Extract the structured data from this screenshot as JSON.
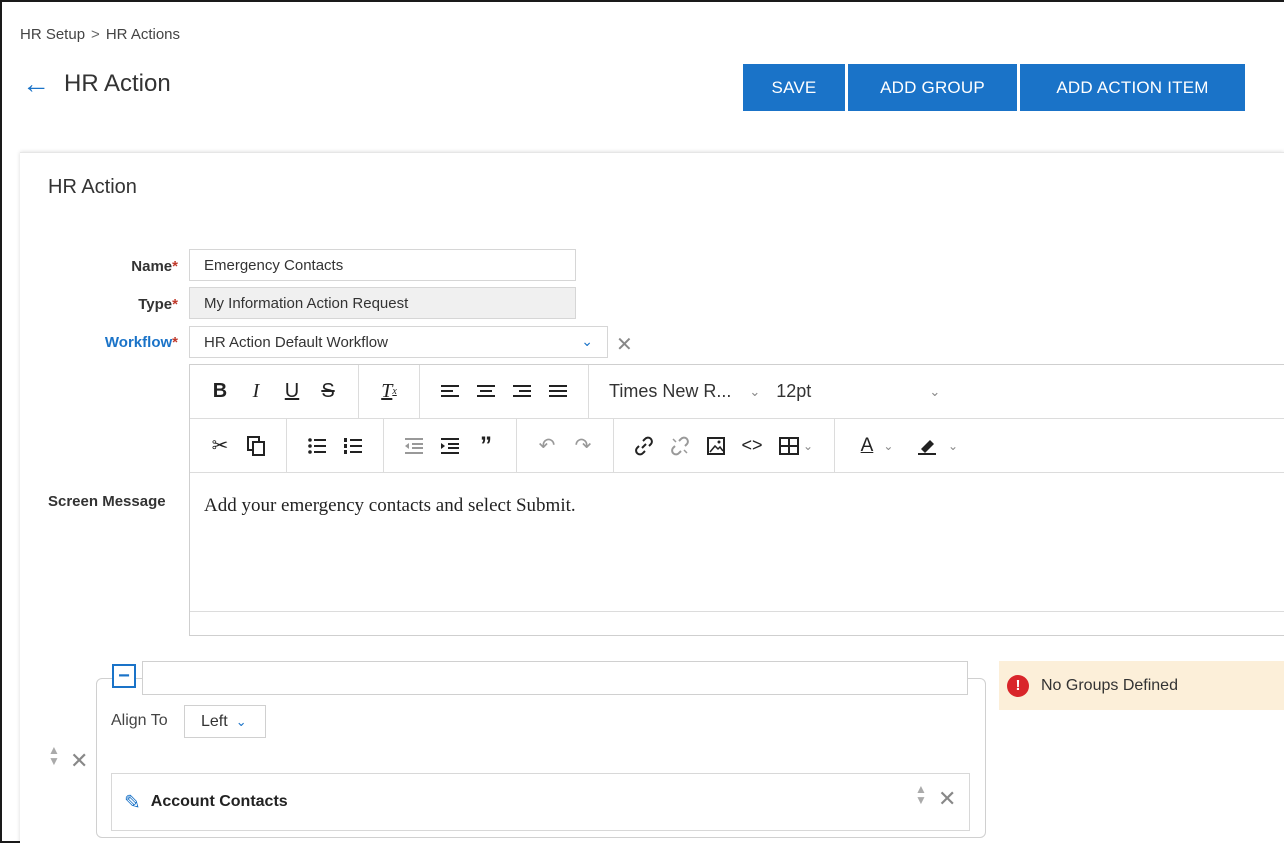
{
  "breadcrumb": {
    "items": [
      "HR Setup",
      "HR Actions"
    ],
    "separator": ">"
  },
  "page": {
    "title": "HR Action"
  },
  "toolbar": {
    "save_label": "SAVE",
    "add_group_label": "ADD GROUP",
    "add_action_item_label": "ADD ACTION ITEM"
  },
  "card": {
    "title": "HR Action"
  },
  "form": {
    "name": {
      "label": "Name",
      "required": "*",
      "value": "Emergency Contacts"
    },
    "type": {
      "label": "Type",
      "required": "*",
      "value": "My Information Action Request"
    },
    "workflow": {
      "label": "Workflow",
      "required": "*",
      "value": "HR Action Default Workflow"
    },
    "screen_message": {
      "label": "Screen Message"
    }
  },
  "editor": {
    "font_family": "Times New R...",
    "font_size": "12pt",
    "content": "Add your emergency contacts and select Submit.",
    "toolbar_row1": [
      "bold-icon",
      "italic-icon",
      "underline-icon",
      "strikethrough-icon",
      "clear-format-icon",
      "align-left-icon",
      "align-center-icon",
      "align-right-icon",
      "align-justify-icon"
    ],
    "toolbar_row2": [
      "cut-icon",
      "copy-icon",
      "bullet-list-icon",
      "numbered-list-icon",
      "outdent-icon",
      "indent-icon",
      "blockquote-icon",
      "undo-icon",
      "redo-icon",
      "link-icon",
      "unlink-icon",
      "image-icon",
      "code-icon",
      "table-icon",
      "font-color-icon",
      "highlight-icon"
    ]
  },
  "group": {
    "name_value": "",
    "align_label": "Align To",
    "align_value": "Left",
    "item_label": "Account Contacts"
  },
  "alert": {
    "text": "No Groups Defined"
  },
  "colors": {
    "primary": "#1a73c8",
    "required": "#c0392b",
    "alert_bg": "#fcefd9",
    "alert_icon": "#d9252a"
  }
}
